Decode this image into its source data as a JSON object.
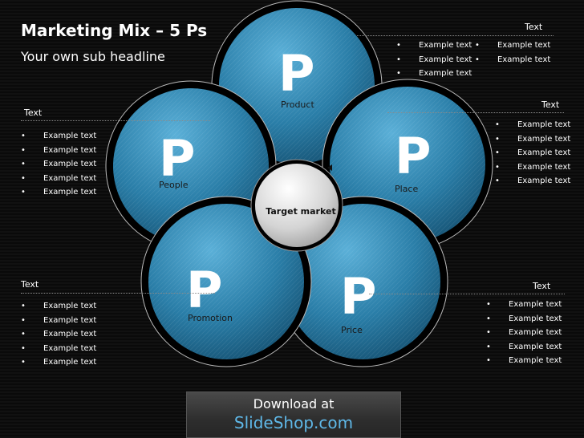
{
  "title": "Marketing Mix – 5 Ps",
  "subtitle": "Your own sub headline",
  "center": "Target market",
  "petal_letter": "P",
  "petals": [
    {
      "name": "Product"
    },
    {
      "name": "Place"
    },
    {
      "name": "Price"
    },
    {
      "name": "Promotion"
    },
    {
      "name": "People"
    }
  ],
  "sections": {
    "top_right": {
      "heading": "Text",
      "col1": [
        "Example text",
        "Example text",
        "Example text"
      ],
      "col2": [
        "Example text",
        "Example text"
      ]
    },
    "right_upper": {
      "heading": "Text",
      "items": [
        "Example text",
        "Example text",
        "Example text",
        "Example text",
        "Example text"
      ]
    },
    "left_upper": {
      "heading": "Text",
      "items": [
        "Example text",
        "Example text",
        "Example text",
        "Example text",
        "Example text"
      ]
    },
    "left_lower": {
      "heading": "Text",
      "items": [
        "Example text",
        "Example text",
        "Example text",
        "Example text",
        "Example text"
      ]
    },
    "right_lower": {
      "heading": "Text",
      "items": [
        "Example text",
        "Example text",
        "Example text",
        "Example text",
        "Example text"
      ]
    }
  },
  "banner": {
    "line1": "Download at",
    "line2": "SlideShop.com"
  },
  "colors": {
    "petal": "#2a7ea8",
    "petal_light": "#5bb0d8",
    "accent_link": "#5fb8e8"
  }
}
